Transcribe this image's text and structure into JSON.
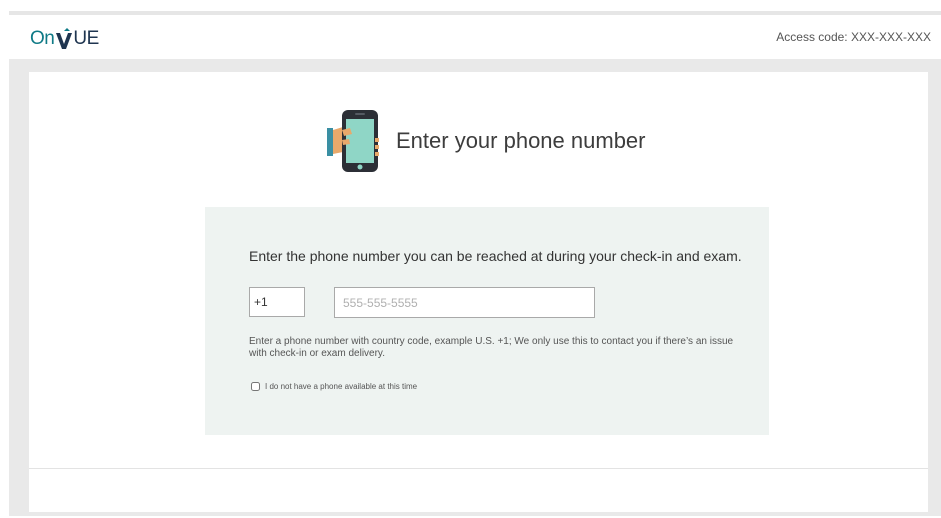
{
  "header": {
    "logo": {
      "prefix": "On",
      "mark": "V",
      "suffix": "UE"
    },
    "access_code": "Access code: XXX-XXX-XXX"
  },
  "main": {
    "title": "Enter your phone number",
    "title_icon": "phone-in-hand-icon",
    "instruction": "Enter the phone number you can be reached at during your check-in and exam.",
    "country_code": {
      "value": "+1"
    },
    "phone_field": {
      "value": "",
      "placeholder": "555-555-5555"
    },
    "helper_text": "Enter a phone number with country code, example U.S. +1; We only use this to contact you if there’s an issue with check-in or exam delivery.",
    "no_phone": {
      "label": "I do not have a phone available at this time",
      "checked": false
    }
  },
  "colors": {
    "brand_teal": "#0f7a86",
    "brand_navy": "#1f3550",
    "panel_background": "#eef3f1",
    "frame_gray": "#e9e9e9"
  }
}
